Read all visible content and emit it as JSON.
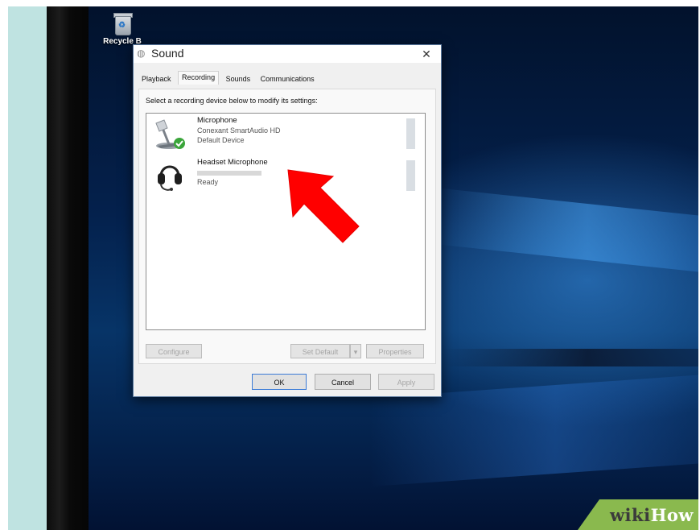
{
  "desktop": {
    "recycle_bin_label": "Recycle B",
    "watermark": {
      "part1": "wiki",
      "part2": "How"
    }
  },
  "dialog": {
    "title": "Sound",
    "close": "✕",
    "tabs": [
      {
        "label": "Playback",
        "active": false
      },
      {
        "label": "Recording",
        "active": true
      },
      {
        "label": "Sounds",
        "active": false
      },
      {
        "label": "Communications",
        "active": false
      }
    ],
    "instruction": "Select a recording device below to modify its settings:",
    "devices": [
      {
        "name": "Microphone",
        "detail": "Conexant SmartAudio HD",
        "status": "Default Device",
        "icon": "microphone-icon",
        "default": true
      },
      {
        "name": "Headset Microphone",
        "detail": "",
        "status": "Ready",
        "icon": "headset-icon",
        "default": false
      }
    ],
    "buttons": {
      "configure": "Configure",
      "set_default": "Set Default",
      "set_default_dropdown": "▾",
      "properties": "Properties",
      "ok": "OK",
      "cancel": "Cancel",
      "apply": "Apply"
    }
  },
  "colors": {
    "arrow": "#ff0000",
    "check_badge": "#3aa53a",
    "watermark_bg": "#8ab94e"
  }
}
